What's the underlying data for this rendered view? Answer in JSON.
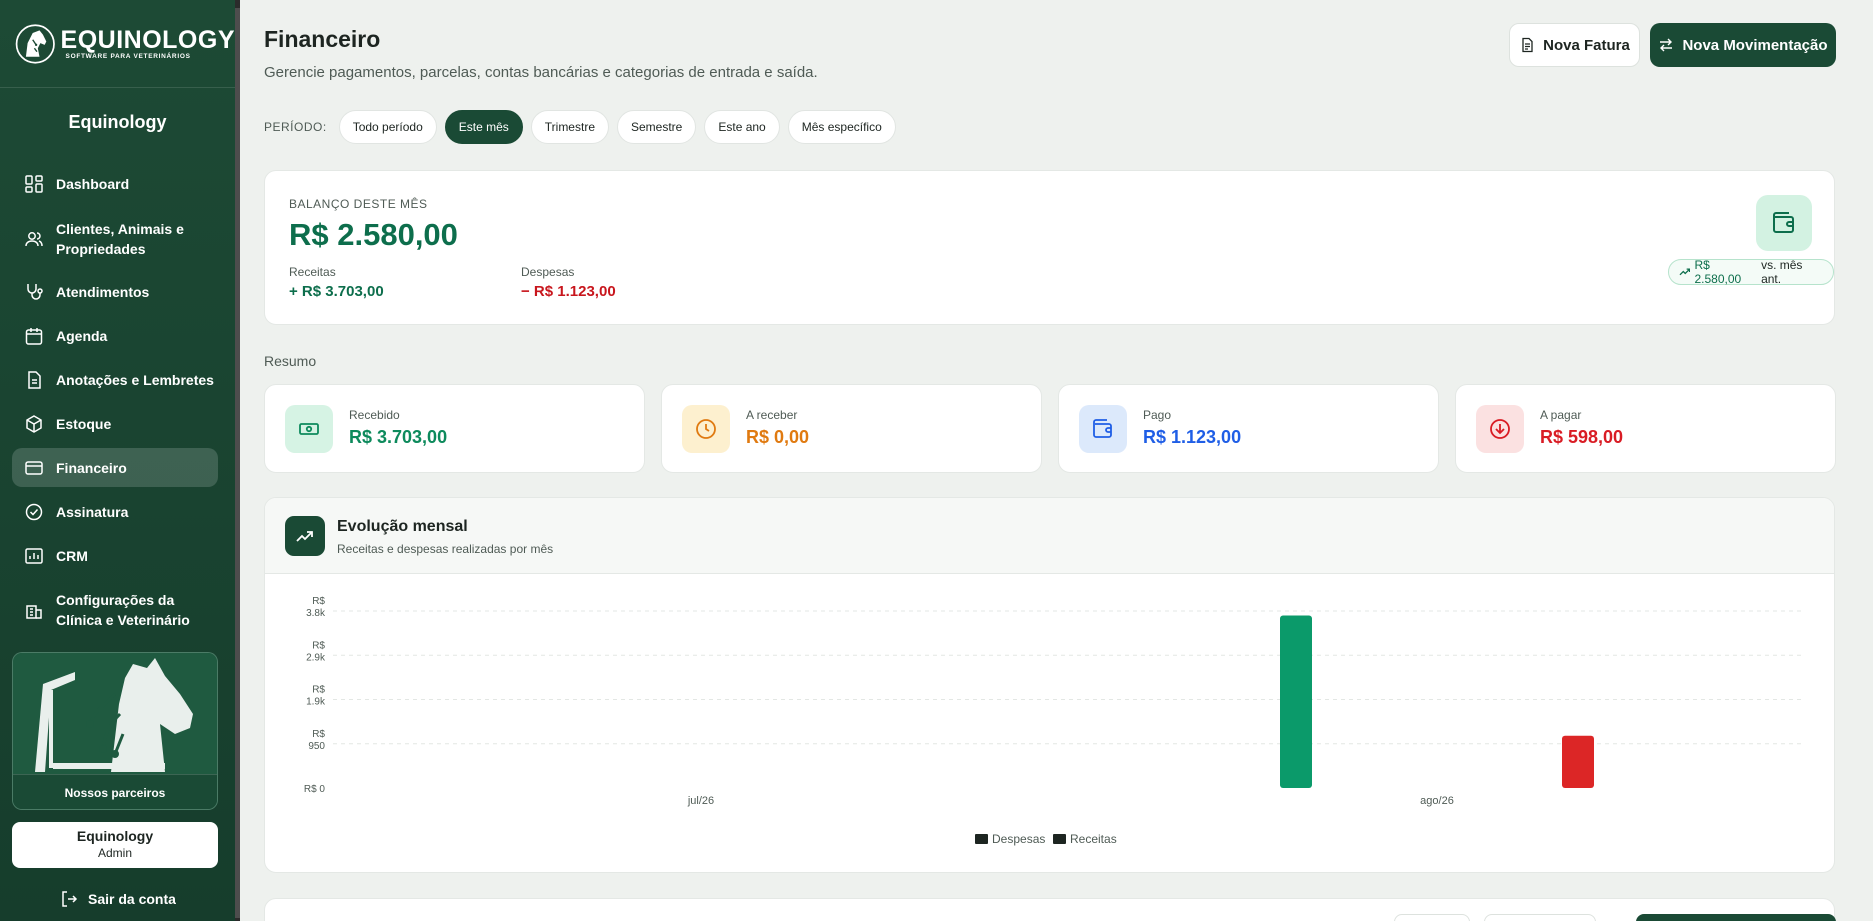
{
  "sidebar": {
    "brand_name": "EQUINOLOGY",
    "brand_tagline": "SOFTWARE PARA VETERINÁRIOS",
    "org_name": "Equinology",
    "items": [
      {
        "label": "Dashboard",
        "icon": "dashboard-icon"
      },
      {
        "label": "Clientes, Animais e Propriedades",
        "icon": "users-icon"
      },
      {
        "label": "Atendimentos",
        "icon": "stethoscope-icon"
      },
      {
        "label": "Agenda",
        "icon": "calendar-icon"
      },
      {
        "label": "Anotações e Lembretes",
        "icon": "notes-icon"
      },
      {
        "label": "Estoque",
        "icon": "package-icon"
      },
      {
        "label": "Financeiro",
        "icon": "credit-card-icon",
        "active": true
      },
      {
        "label": "Assinatura",
        "icon": "badge-check-icon"
      },
      {
        "label": "CRM",
        "icon": "crm-chart-icon"
      },
      {
        "label": "Configurações da Clínica e Veterinário",
        "icon": "building-icon"
      }
    ],
    "partners_label": "Nossos parceiros",
    "user_name": "Equinology",
    "user_role": "Admin",
    "logout_label": "Sair da conta"
  },
  "header": {
    "title": "Financeiro",
    "subtitle": "Gerencie pagamentos, parcelas, contas bancárias e categorias de entrada e saída.",
    "btn_invoice": "Nova Fatura",
    "btn_movement": "Nova Movimentação"
  },
  "period": {
    "label": "PERÍODO:",
    "options": [
      "Todo período",
      "Este mês",
      "Trimestre",
      "Semestre",
      "Este ano",
      "Mês específico"
    ],
    "selected": "Este mês"
  },
  "balance": {
    "label": "BALANÇO DESTE MÊS",
    "value": "R$ 2.580,00",
    "income_label": "Receitas",
    "income_value": "+ R$ 3.703,00",
    "expense_label": "Despesas",
    "expense_value": "− R$ 1.123,00",
    "trend_value": "R$ 2.580,00",
    "trend_suffix": "vs. mês ant."
  },
  "summary": {
    "title": "Resumo",
    "cards": [
      {
        "label": "Recebido",
        "value": "R$ 3.703,00",
        "color": "#0d8a5c",
        "bg": "#d6f3e4",
        "icon": "money-icon"
      },
      {
        "label": "A receber",
        "value": "R$ 0,00",
        "color": "#e07a10",
        "bg": "#fdf0cf",
        "icon": "clock-icon"
      },
      {
        "label": "Pago",
        "value": "R$ 1.123,00",
        "color": "#1f5ee6",
        "bg": "#dce9fb",
        "icon": "wallet-icon"
      },
      {
        "label": "A pagar",
        "value": "R$ 598,00",
        "color": "#d91c24",
        "bg": "#fbe1e1",
        "icon": "arrow-down-circle-icon"
      }
    ]
  },
  "chart": {
    "title": "Evolução mensal",
    "subtitle": "Receitas e despesas realizadas por mês"
  },
  "chart_data": {
    "type": "bar",
    "categories": [
      "jul/26",
      "ago/26"
    ],
    "series": [
      {
        "name": "Receitas",
        "values": [
          0,
          3703
        ],
        "color": "#0b9a6a"
      },
      {
        "name": "Despesas",
        "values": [
          0,
          1123
        ],
        "color": "#dc2626"
      }
    ],
    "y_ticks": [
      {
        "value": 0,
        "label": [
          "R$ 0"
        ]
      },
      {
        "value": 950,
        "label": [
          "R$",
          "950"
        ]
      },
      {
        "value": 1900,
        "label": [
          "R$",
          "1.9k"
        ]
      },
      {
        "value": 2850,
        "label": [
          "R$",
          "2.9k"
        ]
      },
      {
        "value": 3800,
        "label": [
          "R$",
          "3.8k"
        ]
      }
    ],
    "ylim": [
      0,
      4000
    ],
    "legend_order": [
      "Despesas",
      "Receitas"
    ],
    "legend_placement": "bottom",
    "grid": true
  }
}
